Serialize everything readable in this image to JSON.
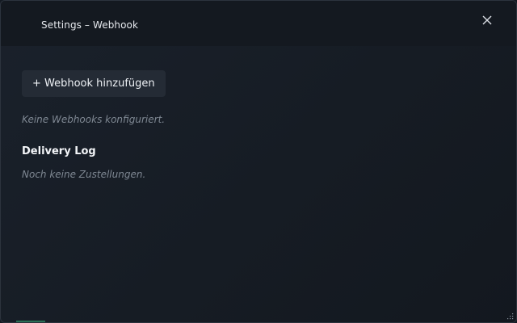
{
  "window": {
    "title": "Settings – Webhook"
  },
  "icons": {
    "close": "close-icon",
    "resize": "resize-grip-icon"
  },
  "toolbar": {
    "add_webhook_label": "+ Webhook hinzufügen"
  },
  "webhooks": {
    "empty_text": "Keine Webhooks konfiguriert."
  },
  "delivery_log": {
    "heading": "Delivery Log",
    "empty_text": "Noch keine Zustellungen."
  },
  "colors": {
    "background": "#161c24",
    "titlebar": "#141920",
    "button": "#242b35",
    "muted_text": "#7f8893"
  }
}
